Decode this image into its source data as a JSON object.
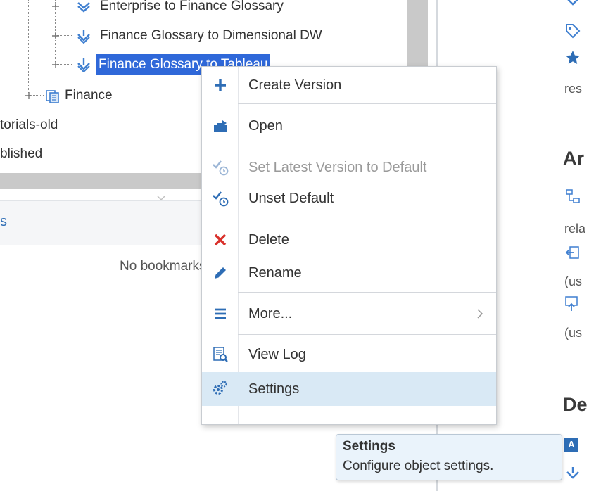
{
  "tree": {
    "items": [
      {
        "label": "Enterprise to Finance Glossary",
        "icon": "mapping-icon"
      },
      {
        "label": "Finance Glossary to Dimensional DW",
        "icon": "mapping-icon"
      },
      {
        "label": "Finance Glossary to Tableau",
        "icon": "mapping-icon",
        "selected": true
      },
      {
        "label": "Finance",
        "icon": "folder-model-icon"
      },
      {
        "label": "torials-old"
      },
      {
        "label": "blished"
      }
    ]
  },
  "bookmarks": {
    "header": "s",
    "empty_text": "No bookmarks"
  },
  "context_menu": {
    "items": [
      {
        "label": "Create Version",
        "icon": "plus-icon"
      },
      {
        "label": "Open",
        "icon": "open-icon"
      },
      {
        "label": "Set Latest Version to Default",
        "icon": "set-default-icon",
        "disabled": true
      },
      {
        "label": "Unset Default",
        "icon": "unset-default-icon"
      },
      {
        "label": "Delete",
        "icon": "delete-icon"
      },
      {
        "label": "Rename",
        "icon": "pencil-icon"
      },
      {
        "label": "More...",
        "icon": "hamburger-icon",
        "submenu": true
      },
      {
        "label": "View Log",
        "icon": "view-log-icon"
      },
      {
        "label": "Settings",
        "icon": "gear-icon",
        "highlighted": true
      }
    ]
  },
  "tooltip": {
    "title": "Settings",
    "body": "Configure object settings."
  },
  "right_panel": {
    "text1": "res",
    "heading1": "Ar",
    "text2": "rela",
    "text3": "(us",
    "text4": "(us",
    "heading2": "De",
    "badge_letter": "A"
  },
  "colors": {
    "selection": "#2f68d9",
    "menu_hover": "#d9e9f5",
    "tooltip_bg": "#eaf3fb",
    "icon_blue": "#3f7fd0",
    "delete_red": "#d9312b"
  }
}
